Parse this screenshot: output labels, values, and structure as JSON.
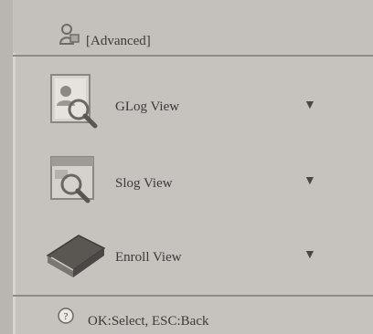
{
  "header": {
    "title": "[Advanced]",
    "icon": "user-lock-icon"
  },
  "menu": {
    "items": [
      {
        "label": "GLog View",
        "icon": "glog-magnifier-icon",
        "arrow": "▼"
      },
      {
        "label": "Slog View",
        "icon": "slog-magnifier-icon",
        "arrow": "▼"
      },
      {
        "label": "Enroll View",
        "icon": "book-icon",
        "arrow": "▼"
      }
    ]
  },
  "footer": {
    "hint": "OK:Select, ESC:Back",
    "icon": "help-icon"
  }
}
